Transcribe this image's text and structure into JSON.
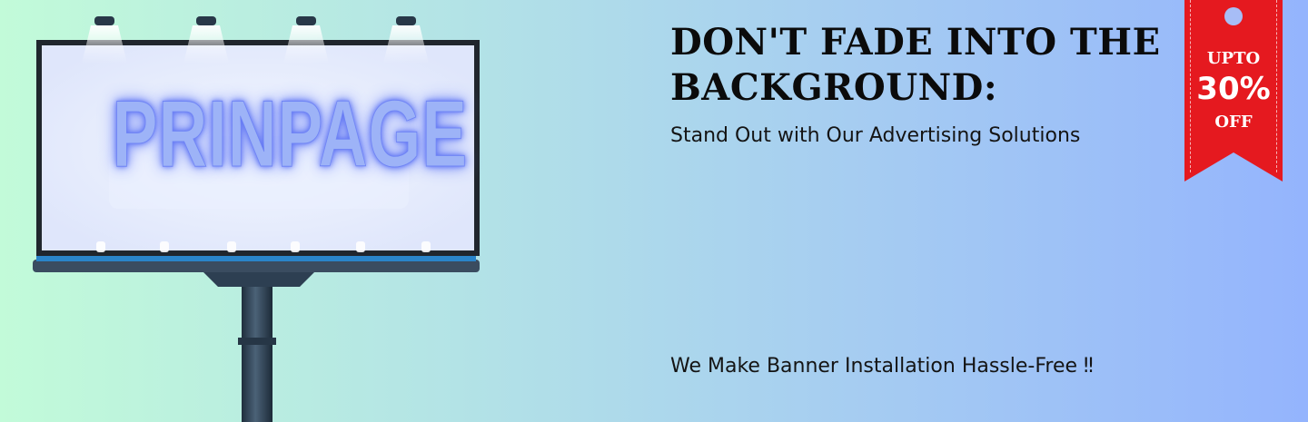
{
  "billboard": {
    "brand_text": "PRINPAGE",
    "icon": "billboard-icon"
  },
  "hero": {
    "headline": "DON'T FADE INTO THE BACKGROUND:",
    "subheadline": "Stand Out with Our Advertising Solutions",
    "tagline": "We Make Banner Installation Hassle-Free ‼"
  },
  "offer_ribbon": {
    "line1": "UPTO",
    "discount": "30%",
    "line3": "OFF",
    "color": "#e5191f"
  },
  "colors": {
    "background_start": "#c2fbd9",
    "background_end": "#94b4fd",
    "headline": "#0b0b0b"
  }
}
